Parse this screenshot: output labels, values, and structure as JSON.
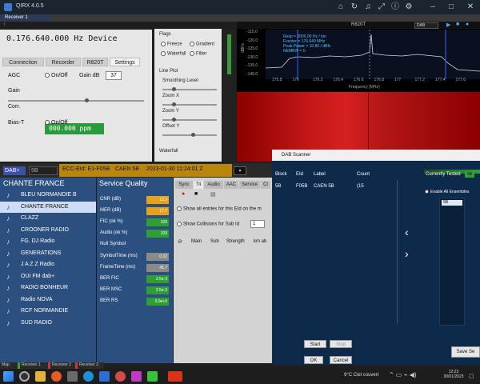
{
  "window": {
    "title": "QIRX 4.0.5",
    "tab": "Receiver 1"
  },
  "device": {
    "frequency": "0.176.640.000 Hz Device",
    "tabs": [
      "Connection",
      "Recorder",
      "R820T",
      "Settings"
    ],
    "agc_label": "AGC",
    "agc_value": "On/Off",
    "gain_label": "Gain dB",
    "gain_value": "37",
    "gain": "Gain",
    "corr_label": "Corr.",
    "corr_value": "000.000 ppm",
    "biast_label": "Bias-T",
    "biast_value": "On/Off"
  },
  "flags": {
    "title": "Flags",
    "freeze": "Freeze",
    "gradient": "Gradient",
    "waterfall": "Waterfall",
    "filter": "Filter",
    "lineplot": "Line Plot",
    "smoothing": "Smoothing Level",
    "zoomx": "Zoom X",
    "zoomy": "Zoom Y",
    "offsety": "Offset Y",
    "waterfall2": "Waterfall"
  },
  "spectrum": {
    "title": "R820T",
    "mode": "DAB",
    "yaxis": [
      "-115.0",
      "-120.0",
      "-125.0",
      "-130.0",
      "-135.0",
      "-140.0"
    ],
    "ylabel": "dBFs",
    "xaxis": [
      "175.8",
      "176",
      "176.2",
      "176.4",
      "176.6",
      "176.8",
      "177",
      "177.2",
      "177.4",
      "177.6"
    ],
    "xlabel": "Frequency (MHz)",
    "info": [
      "Resp = 3000.00 Hz / bin",
      "Fcenter = 176.640 MHz",
      "Peak.Power = 10.80 / dBfs",
      "NEMBW = 0"
    ]
  },
  "dab": {
    "mode": "DAB+",
    "ensemble_id": "5B",
    "ecc": "ECC-EId: E1-F05B",
    "ensemble": "CAEN 5B",
    "datetime": "2023-01-30   11:24:01 Z"
  },
  "services": {
    "header": "CHANTE FRANCE",
    "items": [
      "BLEU NORMANDIE B",
      "CHANTE FRANCE",
      "CLAZZ",
      "CROONER RADIO",
      "FG. DJ Radio",
      "GENERATIONS",
      "J A Z Z Radio",
      "OUI FM dab+",
      "RADIO BONHEUR",
      "Radio NOVA",
      "RCF NORMANDIE",
      "SUD RADIO"
    ],
    "selected": 1
  },
  "quality": {
    "header": "Service Quality",
    "rows": [
      {
        "label": "CNR (dB)",
        "value": "13.3",
        "color": "#e8a21a"
      },
      {
        "label": "MER (dB)",
        "value": "17.7",
        "color": "#e8a21a"
      },
      {
        "label": "FIC (ok %)",
        "value": "100",
        "color": "#2e9e35"
      },
      {
        "label": "Audio (ok %)",
        "value": "100",
        "color": "#2e9e35"
      },
      {
        "label": "Null Symbol",
        "value": "",
        "color": ""
      },
      {
        "label": "SymbolTime (ms)",
        "value": "0.32",
        "color": "#8a8a8a"
      },
      {
        "label": "FrameTime (ms)",
        "value": "45.7",
        "color": "#8a8a8a"
      },
      {
        "label": "BER FIC",
        "value": "2.5e-3",
        "color": "#2e9e35"
      },
      {
        "label": "BER MSC",
        "value": "2.5e-3",
        "color": "#2e9e35"
      },
      {
        "label": "BER RS",
        "value": "0.0e+0",
        "color": "#2e9e35"
      }
    ]
  },
  "mid": {
    "tabs": [
      "Sync",
      "TII",
      "Audio",
      "AAC",
      "Service",
      "Cl"
    ],
    "opt1": "Show all entries for this EId on the m",
    "opt2": "Show Collisions for Sub Id",
    "sub_value": "1",
    "cols": [
      "Main",
      "Sub",
      "Strength",
      "km ab"
    ]
  },
  "scanner": {
    "title": "DAB Scanner",
    "cols": [
      "Block",
      "EId",
      "Label",
      "Count"
    ],
    "row": [
      "5B",
      "F05B",
      "CAEN 5B",
      "(15"
    ],
    "currently_tested": "Currently Tested",
    "current_block": "5B",
    "enable_all": "Enable All Ensembles",
    "selected_block": "5B",
    "start": "Start",
    "stop": "Stop",
    "ok": "OK",
    "cancel": "Cancel",
    "save": "Save Se"
  },
  "statusbar": {
    "tabs": [
      "Map",
      "Receiver 1",
      "Receiver 2",
      "Receiver 3"
    ]
  },
  "taskbar": {
    "weather": "9°C  Ciel couvert",
    "time": "12:23",
    "date": "30/01/2023"
  }
}
